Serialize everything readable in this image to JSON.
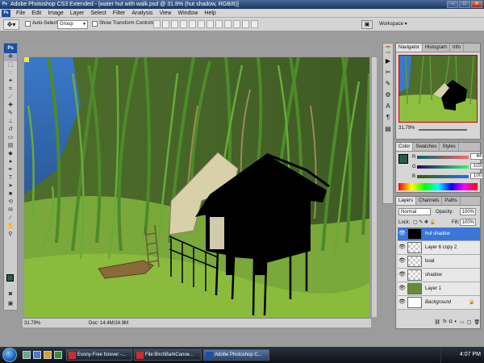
{
  "window": {
    "title": "Adobe Photoshop CS3 Extended - [water hut with walk.psd @ 31.8% (hut shadow, RGB/8)]"
  },
  "menu": [
    "File",
    "Edit",
    "Image",
    "Layer",
    "Select",
    "Filter",
    "Analysis",
    "View",
    "Window",
    "Help"
  ],
  "options": {
    "auto_select_label": "Auto-Select:",
    "auto_select_value": "Group",
    "show_transform_label": "Show Transform Controls",
    "workspace_label": "Workspace ▾"
  },
  "toolbox": {
    "logo": "Ps",
    "fg_color": "#2b5a50",
    "bg_color": "#ffffff"
  },
  "document": {
    "zoom": "31.79%",
    "docsize": "Doc: 14.4M/24.9M"
  },
  "navigator": {
    "tabs": [
      "Navigator",
      "Histogram",
      "Info"
    ],
    "zoom": "31.79%"
  },
  "color": {
    "tabs": [
      "Color",
      "Swatches",
      "Styles"
    ],
    "r_label": "R",
    "r": "44",
    "g_label": "G",
    "g": "103",
    "b_label": "B",
    "b": "100",
    "swatch": "#2b5a50"
  },
  "layers": {
    "tabs": [
      "Layers",
      "Channels",
      "Paths"
    ],
    "blend_mode": "Normal",
    "opacity_label": "Opacity:",
    "opacity": "100%",
    "lock_label": "Lock:",
    "fill_label": "Fill:",
    "fill": "100%",
    "items": [
      {
        "name": "hut shadow",
        "active": true
      },
      {
        "name": "Layer 6 copy 2",
        "active": false
      },
      {
        "name": "boat",
        "active": false
      },
      {
        "name": "shadow",
        "active": false
      },
      {
        "name": "Layer 1",
        "active": false
      },
      {
        "name": "Background",
        "active": false
      }
    ]
  },
  "taskbar": {
    "tasks": [
      "Evony-Free forever -...",
      "File:BirchBarkCanoe...",
      "Adobe Photoshop C..."
    ],
    "clock": "4:07 PM"
  }
}
